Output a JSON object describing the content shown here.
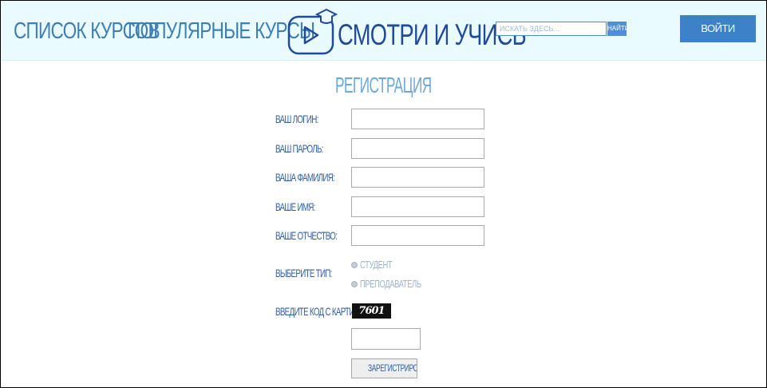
{
  "header": {
    "nav": {
      "courses_label": "СПИСОК КУРСОВ",
      "popular_label": "ПОПУЛЯРНЫЕ КУРСЫ"
    },
    "logo_text": "СМОТРИ И УЧИСЬ",
    "search": {
      "placeholder": "ИСКАТЬ ЗДЕСЬ...",
      "button_label": "НАЙТИ"
    },
    "login_label": "ВОЙТИ"
  },
  "form": {
    "title": "РЕГИСТРАЦИЯ",
    "login_label": "ВАШ ЛОГИН:",
    "password_label": "ВАШ ПАРОЛЬ:",
    "surname_label": "ВАША ФАМИЛИЯ:",
    "name_label": "ВАШЕ ИМЯ:",
    "patronymic_label": "ВАШЕ ОТЧЕСТВО:",
    "type_label": "ВЫБЕРИТЕ ТИП:",
    "type_options": [
      "СТУДЕНТ",
      "ПРЕПОДАВАТЕЛЬ"
    ],
    "captcha_label": "ВВЕДИТЕ КОД С КАРТИНКИ:",
    "captcha_code": "7601",
    "submit_label": "ЗАРЕГИСТРИРОВАТЬСЯ"
  },
  "colors": {
    "header_bg": "#eafbfd",
    "link": "#3d7fb4",
    "logo": "#214a9a",
    "button": "#3c82c8",
    "title": "#6fa9d6",
    "label": "#2f5fa5"
  }
}
